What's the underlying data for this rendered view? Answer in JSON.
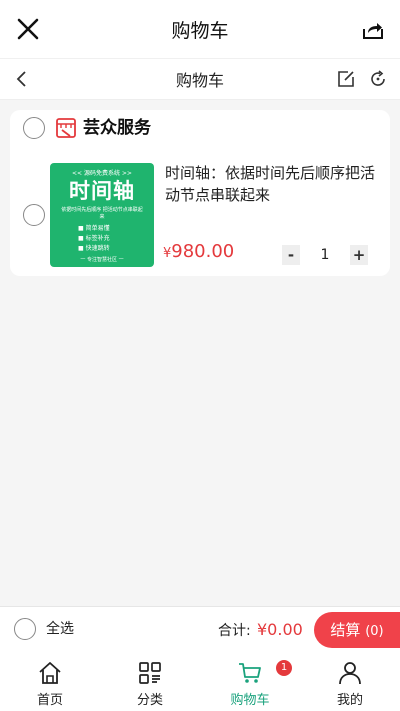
{
  "window": {
    "title": "购物车"
  },
  "page": {
    "title": "购物车"
  },
  "shop": {
    "name": "芸众服务"
  },
  "item": {
    "title": "时间轴：依据时间先后顺序把活动节点串联起来",
    "currency": "¥",
    "price": "980.00",
    "quantity": "1",
    "minus_label": "-",
    "plus_label": "+",
    "thumbnail": {
      "tag": "<< 源码免费系统 >>",
      "heading": "时间轴",
      "sub": "依据时间先后顺序 把活动节点串联起来",
      "features": [
        "简单易懂",
        "标签补充",
        "快速跳转"
      ],
      "footer": "一 专注智慧社区 一"
    }
  },
  "checkout": {
    "select_all": "全选",
    "total_label": "合计:",
    "total_value": "¥0.00",
    "pay_label": "结算",
    "pay_count": "(0)"
  },
  "tabs": [
    {
      "label": "首页",
      "icon": "home-icon"
    },
    {
      "label": "分类",
      "icon": "category-icon"
    },
    {
      "label": "购物车",
      "icon": "cart-icon",
      "active": true
    },
    {
      "label": "我的",
      "icon": "user-icon"
    }
  ],
  "cart_badge": "1",
  "colors": {
    "accent": "#1aa27d",
    "price": "#e4393c",
    "pay_button": "#f0424a",
    "thumb_bg": "#1fb46e"
  }
}
